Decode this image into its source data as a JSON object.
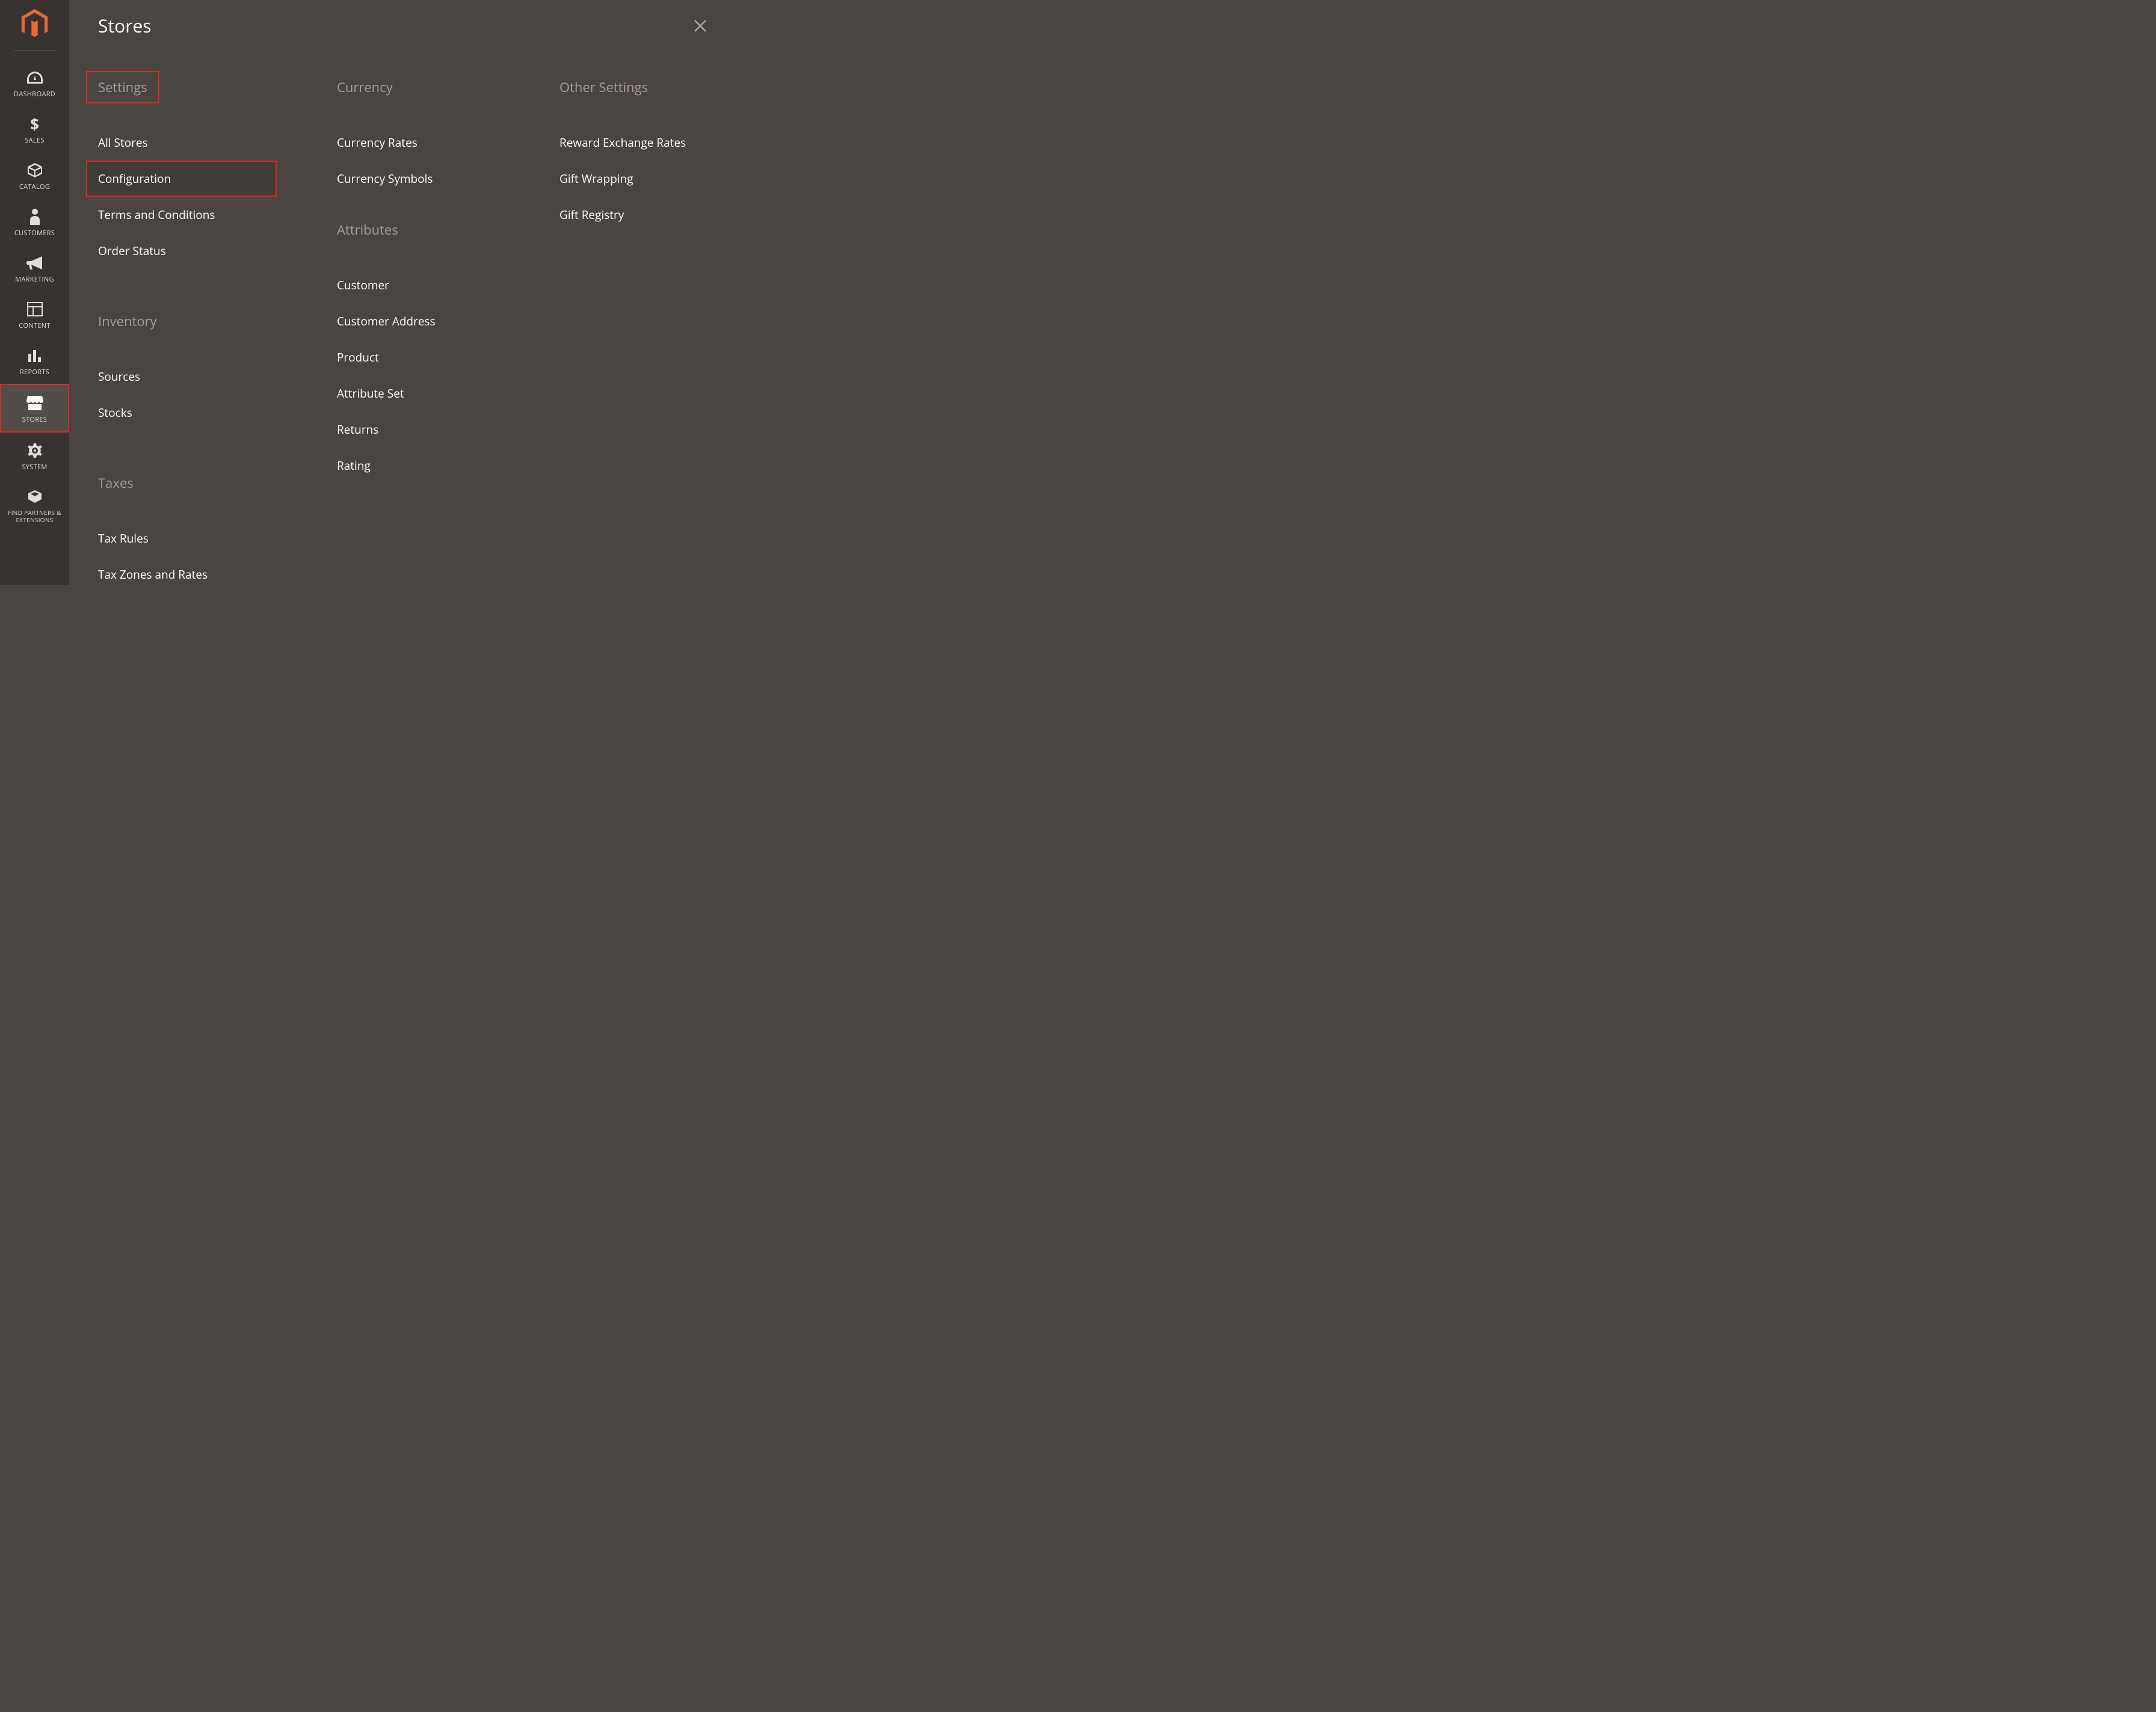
{
  "panel": {
    "title": "Stores"
  },
  "sidebar": {
    "items": [
      {
        "label": "DASHBOARD"
      },
      {
        "label": "SALES"
      },
      {
        "label": "CATALOG"
      },
      {
        "label": "CUSTOMERS"
      },
      {
        "label": "MARKETING"
      },
      {
        "label": "CONTENT"
      },
      {
        "label": "REPORTS"
      },
      {
        "label": "STORES"
      },
      {
        "label": "SYSTEM"
      },
      {
        "label": "FIND PARTNERS & EXTENSIONS"
      }
    ]
  },
  "col1": {
    "settings": {
      "heading": "Settings",
      "items": [
        {
          "label": "All Stores"
        },
        {
          "label": "Configuration"
        },
        {
          "label": "Terms and Conditions"
        },
        {
          "label": "Order Status"
        }
      ]
    },
    "inventory": {
      "heading": "Inventory",
      "items": [
        {
          "label": "Sources"
        },
        {
          "label": "Stocks"
        }
      ]
    },
    "taxes": {
      "heading": "Taxes",
      "items": [
        {
          "label": "Tax Rules"
        },
        {
          "label": "Tax Zones and Rates"
        }
      ]
    }
  },
  "col2": {
    "currency": {
      "heading": "Currency",
      "items": [
        {
          "label": "Currency Rates"
        },
        {
          "label": "Currency Symbols"
        }
      ]
    },
    "attributes": {
      "heading": "Attributes",
      "items": [
        {
          "label": "Customer"
        },
        {
          "label": "Customer Address"
        },
        {
          "label": "Product"
        },
        {
          "label": "Attribute Set"
        },
        {
          "label": "Returns"
        },
        {
          "label": "Rating"
        }
      ]
    }
  },
  "col3": {
    "other": {
      "heading": "Other Settings",
      "items": [
        {
          "label": "Reward Exchange Rates"
        },
        {
          "label": "Gift Wrapping"
        },
        {
          "label": "Gift Registry"
        }
      ]
    }
  }
}
